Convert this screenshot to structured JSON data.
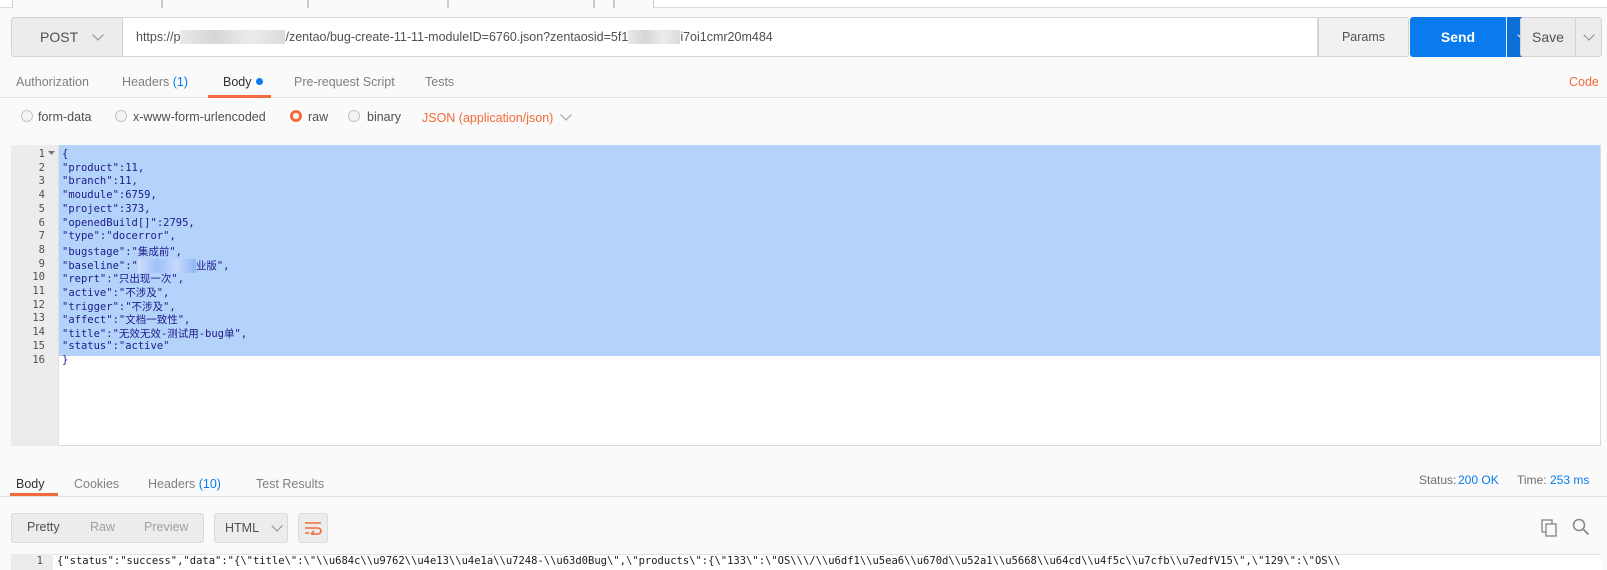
{
  "request": {
    "method": "POST",
    "url_part1": "https://p",
    "url_part2": "/zentao/bug-create-11-11-moduleID=6760.json?zentaosid=5f1",
    "url_part3": "i7oi1cmr20m484",
    "params_label": "Params",
    "send_label": "Send",
    "save_label": "Save"
  },
  "request_tabs": {
    "authorization": "Authorization",
    "headers": "Headers",
    "headers_count": "(1)",
    "body": "Body",
    "prerequest": "Pre-request Script",
    "tests": "Tests",
    "code": "Code"
  },
  "body_options": {
    "form_data": "form-data",
    "urlencoded": "x-www-form-urlencoded",
    "raw": "raw",
    "binary": "binary",
    "content_type": "JSON (application/json)",
    "selected": "raw"
  },
  "editor": {
    "line_numbers": [
      "1",
      "2",
      "3",
      "4",
      "5",
      "6",
      "7",
      "8",
      "9",
      "10",
      "11",
      "12",
      "13",
      "14",
      "15",
      "16"
    ],
    "lines": [
      "{",
      "\"product\":11,",
      "\"branch\":11,",
      "\"moudule\":6759,",
      "\"project\":373,",
      "\"openedBuild[]\":2795,",
      "\"type\":\"docerror\",",
      "\"bugstage\":\"集成前\",",
      "\"baseline\":\"",
      "\"reprt\":\"只出现一次\",",
      "\"active\":\"不涉及\",",
      "\"trigger\":\"不涉及\",",
      "\"affect\":\"文档一致性\",",
      "\"title\":\"无效无效-测试用-bug单\",",
      "\"status\":\"active\"",
      "}"
    ],
    "baseline_suffix": "业版\","
  },
  "response_tabs": {
    "body": "Body",
    "cookies": "Cookies",
    "headers": "Headers",
    "headers_count": "(10)",
    "test_results": "Test Results"
  },
  "response_meta": {
    "status_label": "Status:",
    "status_value": "200 OK",
    "time_label": "Time:",
    "time_value": "253 ms"
  },
  "response_toolbar": {
    "pretty": "Pretty",
    "raw": "Raw",
    "preview": "Preview",
    "format": "HTML"
  },
  "response_body": {
    "line_number": "1",
    "text": "{\"status\":\"success\",\"data\":\"{\\\"title\\\":\\\"\\\\u684c\\\\u9762\\\\u4e13\\\\u4e1a\\\\u7248-\\\\u63d0Bug\\\",\\\"products\\\":{\\\"133\\\":\\\"OS\\\\\\/\\\\u6df1\\\\u5ea6\\\\u670d\\\\u52a1\\\\u5668\\\\u64cd\\\\u4f5c\\\\u7cfb\\\\u7edfV15\\\",\\\"129\\\":\\\"OS\\\\"
  },
  "colors": {
    "accent_orange": "#f26b3a",
    "send_blue": "#097bed",
    "selection": "#b4d3fb"
  }
}
